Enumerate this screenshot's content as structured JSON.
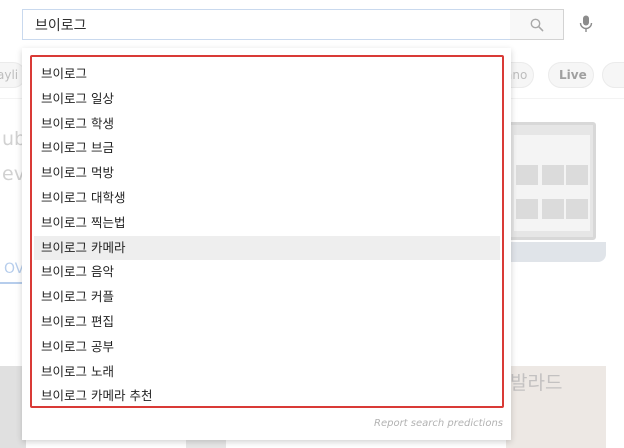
{
  "search": {
    "query": "브이로그"
  },
  "background": {
    "chips": [
      "ayli",
      "ano",
      "Live",
      ""
    ],
    "ghost_lines": [
      "ub",
      "ev",
      "OV"
    ],
    "photo_caption": "발라드"
  },
  "dropdown": {
    "suggestions": [
      "브이로그",
      "브이로그 일상",
      "브이로그 학생",
      "브이로그 브금",
      "브이로그 먹방",
      "브이로그 대학생",
      "브이로그 찍는법",
      "브이로그 카메라",
      "브이로그 음악",
      "브이로그 커플",
      "브이로그 편집",
      "브이로그 공부",
      "브이로그 노래",
      "브이로그 카메라 추천"
    ],
    "highlighted_index": 7,
    "report_label": "Report search predictions"
  },
  "colors": {
    "frame": "#d93a36",
    "highlight": "#eeeeee",
    "input_border": "#c9d9ee"
  },
  "icons": {
    "search_button": "search-icon",
    "mic_button": "mic-icon"
  }
}
